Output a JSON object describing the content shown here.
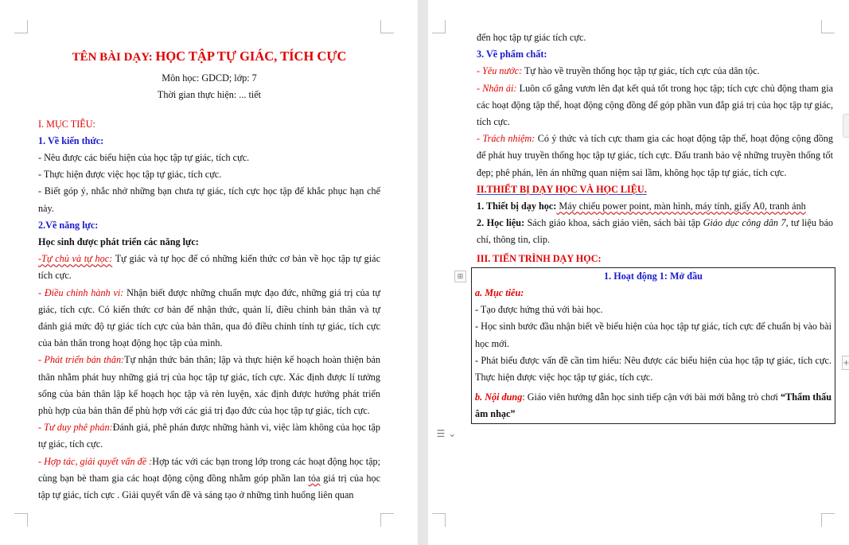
{
  "page1": {
    "title_prefix": "TÊN BÀI DẠY: ",
    "title_main": "HỌC TẬP TỰ GIÁC, TÍCH CỰC",
    "subject": "Môn học: GDCD; lớp: 7",
    "duration": "Thời gian thực hiện: ... tiết",
    "sec1": "I. MỤC TIÊU:",
    "sub1": "1. Về kiến thức:",
    "k1": "- Nêu được các biểu hiện của học tập tự giác, tích cực.",
    "k2": "- Thực hiện được việc học tập tự giác, tích cực.",
    "k3": "- Biết góp ý, nhắc nhở những bạn chưa tự giác, tích cực học tập để khắc phục hạn chế này.",
    "sub2": "2.Về năng lực:",
    "nl_head": "Học sinh được phát triển các năng lực:",
    "nl1_label": "-Tự chủ và tự học:",
    "nl1_text": " Tự giác và tự học để có những kiến thức cơ bản về học tập tự giác tích cực.",
    "nl2_label": " - Điều chỉnh hành vi:",
    "nl2_text": " Nhận biết được những chuẩn mực đạo đức, những giá trị của tự giác, tích cực. Có kiến thức cơ bản để nhận thức, quản lí, điều chỉnh bản thân và tự đánh giá mức độ tự giác tích cực của bản thân, qua đó điều chỉnh tính tự giác, tích cực của bản thân trong hoạt động học tập của mình.",
    "nl3_label": "- Phát triển bản thân:",
    "nl3_text": "Tự nhận thức bản thân; lập và thực hiện kế hoạch hoàn thiện bản thân nhằm phát huy những giá trị của học tập tự giác, tích cực. Xác định được lí tưởng sống của bản thân lập kế hoạch học tập và rèn luyện, xác định được hướng phát triển phù hợp của bản thân để phù hợp với các giá trị đạo đức của học tập tự giác, tích cực.",
    "nl4_label": "- Tư duy phê phán:",
    "nl4_text": "Đánh giá, phê phán được những hành vi, việc làm không của học tập tự giác, tích cực.",
    "nl5_label": "- Hợp tác, giải quyết vấn đề :",
    "nl5_text_a": "Hợp tác với các bạn trong lớp trong các hoạt động học tập; cùng bạn bè tham gia các hoạt động cộng đồng nhằm góp phần lan ",
    "nl5_toa": "tỏa",
    "nl5_text_b": " giá trị của học tập tự giác, tích cực . Giải quyết vấn đề và sáng tạo ở những tình huống liên quan"
  },
  "page2": {
    "cont": "đến học tập tự giác tích cực.",
    "sub3": "3. Về phẩm chất:",
    "pc1_label": "- Yêu nước:",
    "pc1_text": " Tự hào về truyền thống học tập tự giác, tích cực của dân tộc.",
    "pc2_label": "- Nhân ái:",
    "pc2_text": " Luôn cố gắng vươn lên đạt kết quả tốt trong học tập; tích cực chủ động tham gia các hoạt động tập thể, hoạt động cộng đồng để góp phần vun đắp giá trị của học tập tự giác, tích cực.",
    "pc3_label": "- Trách nhiệm:",
    "pc3_text": " Có ý thức và tích cực tham gia các hoạt động tập thể, hoạt động cộng đồng để phát huy truyền thống học tập tự giác, tích cực. Đấu tranh bảo vệ những truyền thống tốt đẹp; phê phán, lên án những quan niệm sai lầm, không học tập tự giác, tích cực.",
    "sec2": "II.THIẾT BỊ DẠY HỌC VÀ HỌC LIỆU.",
    "tb1_label": "1. Thiết bị dạy học:",
    "tb1_text": " Máy chiếu power point, màn hình, máy tính, giấy A0, tranh ảnh",
    "tb2_label": "2. Học liệu:",
    "tb2_text_a": " Sách giáo khoa, sách giáo viên, sách bài tập ",
    "tb2_italic": "Giáo dục công dân 7",
    "tb2_text_b": ", tư liệu báo chí, thông tin, clip.",
    "sec3": "III. TIẾN TRÌNH DẠY HỌC:",
    "box": {
      "header": "1. Hoạt động 1: Mở đầu",
      "a_label": "a. Mục tiêu:",
      "a1": "- Tạo được hứng thú với bài học.",
      "a2": "- Học sinh bước đầu nhận biết về biểu hiện của học tập tự giác, tích cực để chuẩn bị vào bài học mới.",
      "a3": "- Phát biểu được vấn đề cần tìm hiểu: Nêu được các biểu hiện của học tập tự giác, tích cực. Thực hiện được việc học tập tự giác, tích cực.",
      "b_label": "b. Nội dung",
      "b_text": ": Giáo viên hướng dẫn học sinh tiếp cận với bài mới bằng trò chơi ",
      "b_game": "“Thẩm thấu âm nhạc”"
    }
  },
  "ui": {
    "table_handle_icon": "move-handle-icon",
    "layout_icon": "layout-options-icon",
    "add_icon": "plus-icon"
  }
}
